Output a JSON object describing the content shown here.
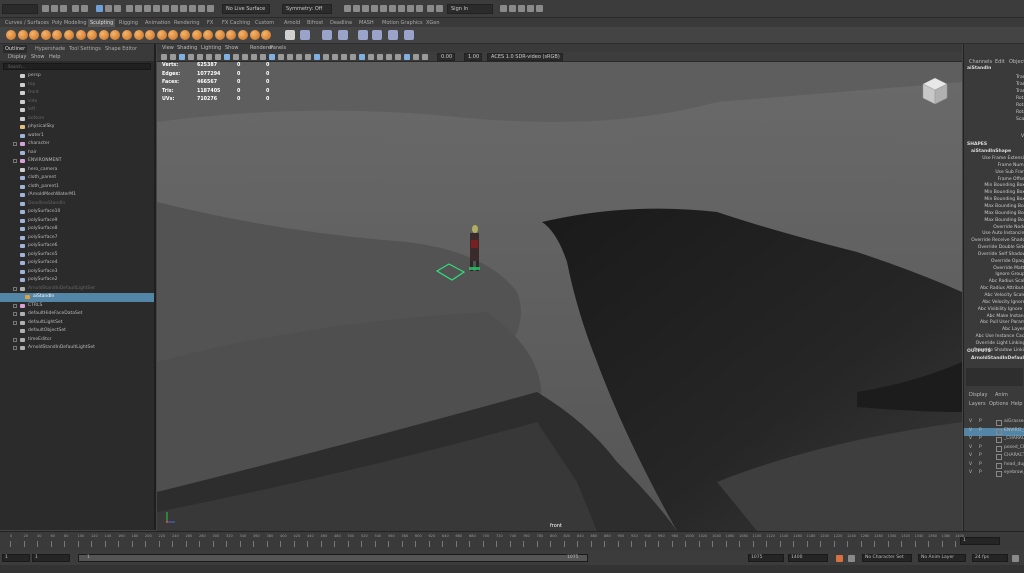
{
  "topbar": {
    "live_surface": "No Live Surface",
    "symmetry": "Symmetry: Off",
    "sign_in": "Sign In"
  },
  "shelf_tabs": [
    "Curves / Surfaces",
    "Poly Modeling",
    "Sculpting",
    "Rigging",
    "Animation",
    "Rendering",
    "FX",
    "FX Caching",
    "Custom",
    "Arnold",
    "Bifrost",
    "Deadline",
    "MASH",
    "Motion Graphics",
    "XGen"
  ],
  "shelf_active_tab": "Sculpting",
  "outliner": {
    "tabs": [
      "Outliner",
      "Hypershade",
      "Tool Settings",
      "Shape Editor"
    ],
    "menu": [
      "Display",
      "Show",
      "Help"
    ],
    "search_placeholder": "Search...",
    "items": [
      {
        "label": "persp",
        "depth": 0,
        "dim": false,
        "icon": "camera-icon"
      },
      {
        "label": "top",
        "depth": 0,
        "dim": true,
        "icon": "camera-icon"
      },
      {
        "label": "front",
        "depth": 0,
        "dim": true,
        "icon": "camera-icon"
      },
      {
        "label": "side",
        "depth": 0,
        "dim": true,
        "icon": "camera-icon"
      },
      {
        "label": "left",
        "depth": 0,
        "dim": true,
        "icon": "camera-icon"
      },
      {
        "label": "bottom",
        "depth": 0,
        "dim": true,
        "icon": "camera-icon"
      },
      {
        "label": "physicalSky",
        "depth": 0,
        "dim": false,
        "icon": "light-icon"
      },
      {
        "label": "water1",
        "depth": 0,
        "dim": false,
        "icon": "mesh-icon"
      },
      {
        "label": "character",
        "depth": 0,
        "dim": false,
        "icon": "group-icon",
        "expandable": true
      },
      {
        "label": "hair",
        "depth": 0,
        "dim": false,
        "icon": "mesh-icon"
      },
      {
        "label": "ENVIRONMENT",
        "depth": 0,
        "dim": false,
        "icon": "group-icon",
        "expandable": true
      },
      {
        "label": "hero_camera",
        "depth": 0,
        "dim": false,
        "icon": "camera-icon"
      },
      {
        "label": "cloth_parent",
        "depth": 0,
        "dim": false,
        "icon": "mesh-icon"
      },
      {
        "label": "cloth_parent1",
        "depth": 0,
        "dim": false,
        "icon": "mesh-icon"
      },
      {
        "label": "/ArnoldMeshWaterM1",
        "depth": 0,
        "dim": false,
        "icon": "mesh-icon"
      },
      {
        "label": "DeadlineStandIn",
        "depth": 0,
        "dim": true,
        "icon": "mesh-icon"
      },
      {
        "label": "polySurface10",
        "depth": 0,
        "dim": false,
        "icon": "mesh-icon"
      },
      {
        "label": "polySurface9",
        "depth": 0,
        "dim": false,
        "icon": "mesh-icon"
      },
      {
        "label": "polySurface8",
        "depth": 0,
        "dim": false,
        "icon": "mesh-icon"
      },
      {
        "label": "polySurface7",
        "depth": 0,
        "dim": false,
        "icon": "mesh-icon"
      },
      {
        "label": "polySurface6",
        "depth": 0,
        "dim": false,
        "icon": "mesh-icon"
      },
      {
        "label": "polySurface5",
        "depth": 0,
        "dim": false,
        "icon": "mesh-icon"
      },
      {
        "label": "polySurface4",
        "depth": 0,
        "dim": false,
        "icon": "mesh-icon"
      },
      {
        "label": "polySurface3",
        "depth": 0,
        "dim": false,
        "icon": "mesh-icon"
      },
      {
        "label": "polySurface2",
        "depth": 0,
        "dim": false,
        "icon": "mesh-icon"
      },
      {
        "label": "ArnoldStandInDefaultLightSet",
        "depth": 0,
        "dim": true,
        "icon": "set-icon",
        "expandable": true
      },
      {
        "label": "aiStandIn",
        "depth": 1,
        "dim": false,
        "icon": "standin-icon",
        "selected": true
      },
      {
        "label": "CTRLS",
        "depth": 0,
        "dim": false,
        "icon": "group-icon",
        "expandable": true
      },
      {
        "label": "defaultHideFaceDataSet",
        "depth": 0,
        "dim": false,
        "icon": "set-icon",
        "expandable": true
      },
      {
        "label": "defaultLightSet",
        "depth": 0,
        "dim": false,
        "icon": "set-icon",
        "expandable": true
      },
      {
        "label": "defaultObjectSet",
        "depth": 0,
        "dim": false,
        "icon": "set-icon"
      },
      {
        "label": "timeEditor",
        "depth": 0,
        "dim": false,
        "icon": "set-icon",
        "expandable": true
      },
      {
        "label": "ArnoldStandInDefaultLightSet",
        "depth": 0,
        "dim": false,
        "icon": "set-icon",
        "expandable": true
      }
    ]
  },
  "viewport": {
    "menu": [
      "View",
      "Shading",
      "Lighting",
      "Show",
      "Renderer",
      "Panels"
    ],
    "exposure": "0.00",
    "gamma": "1.00",
    "colorspace": "ACES 1.0 SDR-video (sRGB)",
    "camera_label": "front",
    "hud": [
      {
        "label": "Verts:",
        "v1": "625387",
        "v2": "0",
        "v3": "0"
      },
      {
        "label": "Edges:",
        "v1": "1077294",
        "v2": "0",
        "v3": "0"
      },
      {
        "label": "Faces:",
        "v1": "466567",
        "v2": "0",
        "v3": "0"
      },
      {
        "label": "Tris:",
        "v1": "1187405",
        "v2": "0",
        "v3": "0"
      },
      {
        "label": "UVs:",
        "v1": "710276",
        "v2": "0",
        "v3": "0"
      }
    ]
  },
  "channel_box": {
    "tabs": [
      "Channels",
      "Edit",
      "Object",
      "Show"
    ],
    "object_name": "aiStandIn",
    "transform_attrs": [
      "Translate X",
      "Translate Y",
      "Translate Z",
      "Rotate X",
      "Rotate Y",
      "Rotate Z",
      "Scale X"
    ],
    "visibility_label": "Visibility",
    "shapes_header": "SHAPES",
    "shape_name": "aiStandInShape",
    "shape_attrs": [
      "Use Frame Extension",
      "Frame Number",
      "Use Sub Frame",
      "Frame Offset",
      "Min Bounding Box X",
      "Min Bounding Box Y",
      "Min Bounding Box Z",
      "Max Bounding Box X",
      "Max Bounding Box Y",
      "Max Bounding Box Z",
      "Override Nodes",
      "Use Auto Instancing",
      "Override Receive Shadows",
      "Override Double Sided",
      "Override Self Shadows",
      "Override Opaque",
      "Override Matte",
      "Ignore Groups",
      "Abc Radius Scale",
      "Abc Radius Attribute",
      "Abc Velocity Scale",
      "Abc Velocity Ignore",
      "Abc Visibility Ignore",
      "Abc Make Instance",
      "Abc Pull User Params",
      "Abc Layers",
      "Abc Use Instance Cache",
      "Override Light Linking",
      "Override Shadow Linking"
    ],
    "outputs_header": "OUTPUTS",
    "output_name": "ArnoldStandInDefaultLightSet",
    "layer_tabs": [
      "Display",
      "Anim"
    ],
    "layer_menu": [
      "Layers",
      "Options",
      "Help"
    ],
    "layers": [
      {
        "v": "V",
        "p": "P",
        "name": "aiGrasses_LYR",
        "selected": false
      },
      {
        "v": "V",
        "p": "P",
        "name": "ENVIRO_LYR",
        "selected": true
      },
      {
        "v": "V",
        "p": "P",
        "name": "_CHARACTER",
        "selected": false
      },
      {
        "v": "V",
        "p": "P",
        "name": "posed_CHAR",
        "selected": false
      },
      {
        "v": "V",
        "p": "P",
        "name": "CHARACTER",
        "selected": false
      },
      {
        "v": "V",
        "p": "P",
        "name": "head_dupe",
        "selected": false
      },
      {
        "v": "V",
        "p": "P",
        "name": "eyebrow_dupe",
        "selected": false
      }
    ]
  },
  "timeline": {
    "ticks": [
      "0",
      "20",
      "40",
      "60",
      "80",
      "100",
      "120",
      "140",
      "160",
      "180",
      "200",
      "220",
      "240",
      "260",
      "280",
      "300",
      "320",
      "340",
      "360",
      "380",
      "400",
      "420",
      "440",
      "460",
      "480",
      "500",
      "520",
      "540",
      "560",
      "580",
      "600",
      "620",
      "640",
      "660",
      "680",
      "700",
      "720",
      "740",
      "760",
      "780",
      "800",
      "820",
      "840",
      "860",
      "880",
      "900",
      "920",
      "940",
      "960",
      "980",
      "1000",
      "1020",
      "1040",
      "1060",
      "1080",
      "1100",
      "1120",
      "1140",
      "1160",
      "1180",
      "1200",
      "1220",
      "1240",
      "1260",
      "1280",
      "1300",
      "1320",
      "1340",
      "1360",
      "1380",
      "1400"
    ],
    "current_frame": "1"
  },
  "range": {
    "start": "1",
    "playback_start": "1",
    "playback_end": "1075",
    "range_mid": "1075",
    "end": "1075",
    "end2": "1400",
    "character_set": "No Character Set",
    "anim_layer": "No Anim Layer",
    "fps": "24 fps"
  }
}
